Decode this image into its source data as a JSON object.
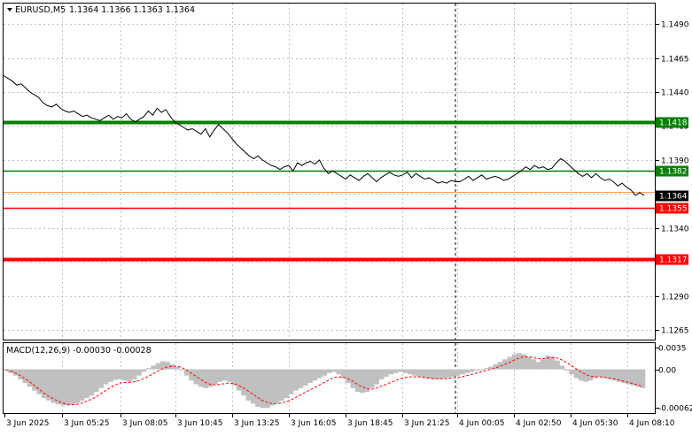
{
  "window": {
    "symbol_label": "EURUSD,M5",
    "ohlc_label": "1.1364 1.1366 1.1363 1.1364"
  },
  "chart_data": [
    {
      "type": "line",
      "series": [
        {
          "values": [
            1.1452,
            1.145,
            1.1448,
            1.1445,
            1.1446,
            1.1443,
            1.144,
            1.1438,
            1.1436,
            1.1432,
            1.143,
            1.1429,
            1.1431,
            1.1428,
            1.1426,
            1.1425,
            1.1426,
            1.1424,
            1.1422,
            1.1423,
            1.1421,
            1.142,
            1.1419,
            1.1421,
            1.1423,
            1.142,
            1.1422,
            1.1421,
            1.1424,
            1.142,
            1.1418,
            1.142,
            1.1422,
            1.1426,
            1.1423,
            1.1428,
            1.1425,
            1.1427,
            1.1422,
            1.1418,
            1.1416,
            1.1414,
            1.1412,
            1.1413,
            1.1411,
            1.1409,
            1.1413,
            1.1407,
            1.1412,
            1.1416,
            1.1413,
            1.141,
            1.1406,
            1.1402,
            1.1399,
            1.1396,
            1.1393,
            1.1391,
            1.1393,
            1.139,
            1.1388,
            1.1386,
            1.1385,
            1.1383,
            1.1385,
            1.1386,
            1.1382,
            1.1388,
            1.1386,
            1.1388,
            1.1389,
            1.1387,
            1.139,
            1.1384,
            1.138,
            1.1382,
            1.138,
            1.1378,
            1.1376,
            1.1379,
            1.1377,
            1.1375,
            1.1378,
            1.138,
            1.1377,
            1.1374,
            1.1377,
            1.1379,
            1.1381,
            1.1379,
            1.1378,
            1.1379,
            1.1381,
            1.1377,
            1.138,
            1.1378,
            1.1376,
            1.1377,
            1.1375,
            1.1373,
            1.1374,
            1.1373,
            1.1375,
            1.1374,
            1.1374,
            1.1376,
            1.1378,
            1.1375,
            1.1377,
            1.1379,
            1.1376,
            1.1377,
            1.1378,
            1.1377,
            1.1375,
            1.1376,
            1.1378,
            1.138,
            1.1382,
            1.1385,
            1.1383,
            1.1386,
            1.1384,
            1.1385,
            1.1383,
            1.1384,
            1.1388,
            1.1391,
            1.1389,
            1.1386,
            1.1383,
            1.138,
            1.1378,
            1.138,
            1.1377,
            1.138,
            1.1377,
            1.1375,
            1.1376,
            1.1374,
            1.1371,
            1.1373,
            1.137,
            1.1368,
            1.1364,
            1.1366,
            1.1364
          ]
        }
      ],
      "x_tick_labels": [
        "3 Jun 2025",
        "3 Jun 05:25",
        "3 Jun 08:05",
        "3 Jun 10:45",
        "3 Jun 13:25",
        "3 Jun 16:05",
        "3 Jun 18:45",
        "3 Jun 21:25",
        "4 Jun 00:05",
        "4 Jun 02:50",
        "4 Jun 05:30",
        "4 Jun 08:10"
      ],
      "y_tick_labels": [
        "1.1490",
        "1.1465",
        "1.1440",
        "1.1415",
        "1.1390",
        "1.1365",
        "1.1340",
        "1.1315",
        "1.1290",
        "1.1265"
      ],
      "ylim": [
        1.1258,
        1.1505
      ],
      "current_price": "1.1364",
      "levels": [
        {
          "label": "1.1418",
          "value": 1.1418,
          "color": "#008000",
          "style": "thick"
        },
        {
          "label": "1.1382",
          "value": 1.1382,
          "color": "#008000",
          "style": "thin"
        },
        {
          "label": "1.1355",
          "value": 1.1355,
          "color": "#ff0000",
          "style": "thin"
        },
        {
          "label": "1.1317",
          "value": 1.1317,
          "color": "#ff0000",
          "style": "thick"
        }
      ],
      "grid": true
    },
    {
      "type": "bar",
      "title": "MACD(12,26,9) -0.00030 -0.00028",
      "histogram": [
        -2e-05,
        -6e-05,
        -0.0001,
        -0.00016,
        -0.00022,
        -0.00028,
        -0.00034,
        -0.0004,
        -0.00046,
        -0.0005,
        -0.00054,
        -0.00056,
        -0.00058,
        -0.00058,
        -0.00057,
        -0.00054,
        -0.0005,
        -0.00046,
        -0.00042,
        -0.00036,
        -0.0003,
        -0.00024,
        -0.0002,
        -0.00017,
        -0.00016,
        -0.00018,
        -0.0002,
        -0.00016,
        -0.0001,
        -4e-05,
        2e-05,
        6e-05,
        0.0001,
        0.00013,
        0.00012,
        8e-05,
        4e-05,
        -2e-05,
        -0.0001,
        -0.00018,
        -0.00024,
        -0.00028,
        -0.0003,
        -0.00028,
        -0.00024,
        -0.0002,
        -0.00018,
        -0.0002,
        -0.00026,
        -0.00034,
        -0.00042,
        -0.0005,
        -0.00055,
        -0.0006,
        -0.00062,
        -0.00062,
        -0.00058,
        -0.00054,
        -0.0005,
        -0.00046,
        -0.0004,
        -0.00034,
        -0.0003,
        -0.00026,
        -0.00022,
        -0.00018,
        -0.00014,
        -0.0001,
        -6e-05,
        -4e-05,
        -8e-05,
        -0.00014,
        -0.00022,
        -0.0003,
        -0.00036,
        -0.00038,
        -0.00036,
        -0.0003,
        -0.00024,
        -0.00016,
        -0.00012,
        -8e-05,
        -6e-05,
        -4e-05,
        -6e-05,
        -8e-05,
        -0.0001,
        -0.00012,
        -0.00014,
        -0.00015,
        -0.00016,
        -0.00016,
        -0.00015,
        -0.00014,
        -0.00012,
        -0.0001,
        -8e-05,
        -6e-05,
        -4e-05,
        -2e-05,
        0.0,
        2e-05,
        4e-05,
        8e-05,
        0.00012,
        0.00016,
        0.0002,
        0.00024,
        0.00026,
        0.00024,
        0.0002,
        0.00016,
        0.00012,
        0.00016,
        0.00022,
        0.0002,
        0.00014,
        6e-05,
        -2e-05,
        -8e-05,
        -0.00014,
        -0.00018,
        -0.0002,
        -0.00018,
        -0.00014,
        -0.00012,
        -0.00014,
        -0.00016,
        -0.00018,
        -0.0002,
        -0.00022,
        -0.00024,
        -0.00026,
        -0.00028,
        -0.0003
      ],
      "signal": [
        -1e-05,
        -3e-05,
        -6e-05,
        -0.0001,
        -0.00015,
        -0.0002,
        -0.00026,
        -0.00032,
        -0.00038,
        -0.00043,
        -0.00047,
        -0.00051,
        -0.00054,
        -0.00056,
        -0.00057,
        -0.00056,
        -0.00054,
        -0.00051,
        -0.00048,
        -0.00044,
        -0.00039,
        -0.00034,
        -0.00029,
        -0.00025,
        -0.00022,
        -0.00021,
        -0.00021,
        -0.0002,
        -0.00018,
        -0.00015,
        -0.00011,
        -7e-05,
        -3e-05,
        1e-05,
        4e-05,
        5e-05,
        5e-05,
        3e-05,
        -1e-05,
        -6e-05,
        -0.00011,
        -0.00016,
        -0.00021,
        -0.00024,
        -0.00025,
        -0.00024,
        -0.00023,
        -0.00022,
        -0.00023,
        -0.00026,
        -0.0003,
        -0.00035,
        -0.0004,
        -0.00045,
        -0.0005,
        -0.00053,
        -0.00055,
        -0.00055,
        -0.00054,
        -0.00052,
        -0.00049,
        -0.00045,
        -0.00041,
        -0.00037,
        -0.00033,
        -0.00029,
        -0.00025,
        -0.00021,
        -0.00017,
        -0.00013,
        -0.00012,
        -0.00013,
        -0.00015,
        -0.00019,
        -0.00024,
        -0.00028,
        -0.00031,
        -0.00032,
        -0.0003,
        -0.00027,
        -0.00024,
        -0.00021,
        -0.00018,
        -0.00015,
        -0.00013,
        -0.00012,
        -0.00012,
        -0.00012,
        -0.00013,
        -0.00014,
        -0.00015,
        -0.00015,
        -0.00015,
        -0.00015,
        -0.00014,
        -0.00013,
        -0.00012,
        -0.0001,
        -8e-05,
        -6e-05,
        -4e-05,
        -2e-05,
        0.0,
        2e-05,
        5e-05,
        8e-05,
        0.00011,
        0.00015,
        0.00018,
        0.0002,
        0.0002,
        0.00019,
        0.00017,
        0.00017,
        0.00018,
        0.00019,
        0.00018,
        0.00015,
        0.00011,
        6e-05,
        1e-05,
        -4e-05,
        -8e-05,
        -0.00011,
        -0.00012,
        -0.00012,
        -0.00013,
        -0.00014,
        -0.00015,
        -0.00017,
        -0.00019,
        -0.00021,
        -0.00023,
        -0.00025,
        -0.00028
      ],
      "y_tick_labels": [
        "0.0035",
        "0.00",
        "-0.00062"
      ],
      "ylim": [
        -0.0007,
        0.00042
      ]
    }
  ],
  "colors": {
    "price_line": "#000000",
    "grid": "#c0c0c0",
    "histogram": "#c0c0c0",
    "signal": "#ff0000",
    "current_price_box": "#000000",
    "current_price_line": "#ff9e57",
    "green_level": "#008000",
    "red_level": "#ff0000"
  }
}
